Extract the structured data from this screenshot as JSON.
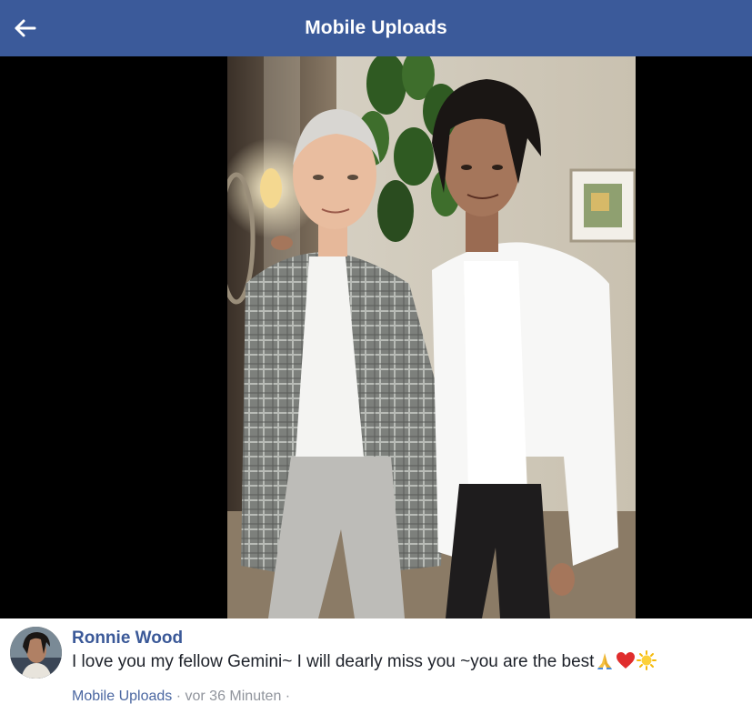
{
  "header": {
    "title": "Mobile Uploads",
    "back_icon": "arrow-left-icon"
  },
  "colors": {
    "header_bg": "#3b5a9a",
    "viewer_bg": "#000000",
    "author_link": "#3b5998",
    "meta_text": "#90949c"
  },
  "post": {
    "author": "Ronnie Wood",
    "text": "I love you my fellow Gemini~ I will dearly miss you ~you are the best",
    "emojis": [
      "folded-hands-icon",
      "red-heart-icon",
      "sun-icon"
    ],
    "album_link": "Mobile Uploads",
    "separator": " · ",
    "timestamp": "vor 36 Minuten",
    "trailing_separator": " ·"
  }
}
